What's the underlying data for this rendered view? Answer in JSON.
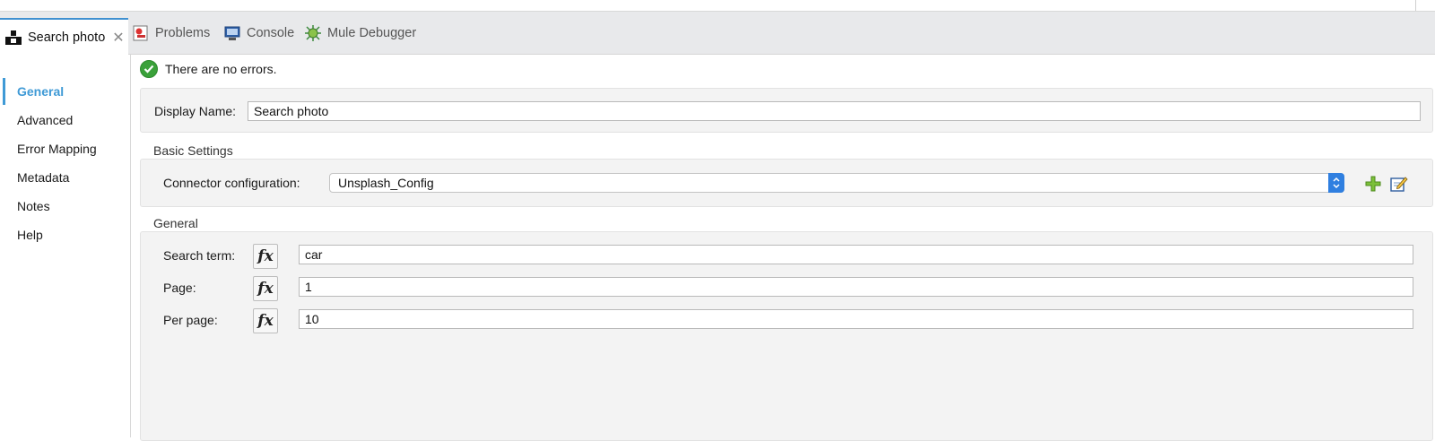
{
  "tabs": [
    {
      "label": "Search photo",
      "icon": "unsplash-icon",
      "active": true
    },
    {
      "label": "Problems",
      "icon": "problems-icon"
    },
    {
      "label": "Console",
      "icon": "console-icon"
    },
    {
      "label": "Mule Debugger",
      "icon": "debugger-icon"
    }
  ],
  "sidebar": {
    "items": [
      {
        "label": "General",
        "active": true
      },
      {
        "label": "Advanced"
      },
      {
        "label": "Error Mapping"
      },
      {
        "label": "Metadata"
      },
      {
        "label": "Notes"
      },
      {
        "label": "Help"
      }
    ]
  },
  "status": {
    "text": "There are no errors.",
    "icon": "check-circle-icon"
  },
  "display": {
    "label": "Display Name:",
    "value": "Search photo"
  },
  "basic_settings": {
    "title": "Basic Settings",
    "connector_label": "Connector configuration:",
    "connector_value": "Unsplash_Config"
  },
  "general": {
    "title": "General",
    "fields": [
      {
        "label": "Search term:",
        "value": "car",
        "fx": "fx"
      },
      {
        "label": "Page:",
        "value": "1",
        "fx": "fx"
      },
      {
        "label": "Per page:",
        "value": "10",
        "fx": "fx"
      }
    ]
  },
  "colors": {
    "accent": "#3f9ad6",
    "tab_active_border": "#3f90d0",
    "ok_green": "#3aa13a",
    "select_blue": "#2f7fe0"
  }
}
